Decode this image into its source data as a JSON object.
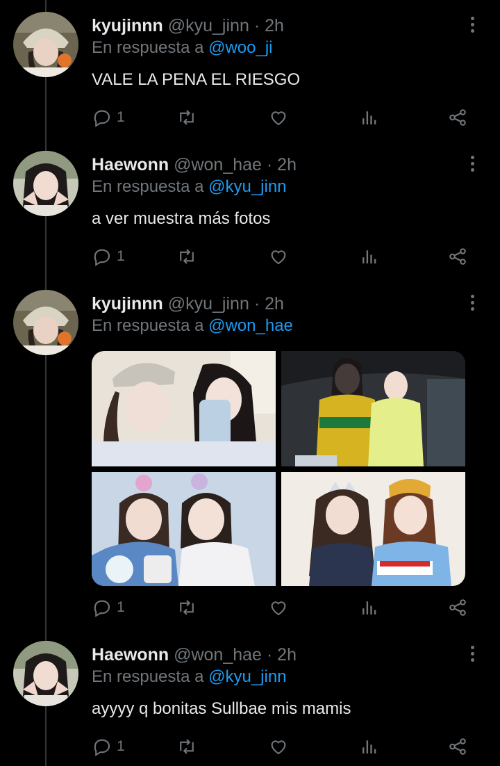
{
  "tweets": [
    {
      "name": "kyujinnn",
      "handle": "@kyu_jinn",
      "dot": "·",
      "time": "2h",
      "reply_prefix": "En respuesta a",
      "reply_to": "@woo_ji",
      "text": "VALE LA PENA EL RIESGO",
      "reply_count": "1",
      "avatar": "girl-with-beige-cap-avatar"
    },
    {
      "name": "Haewonn",
      "handle": "@won_hae",
      "dot": "·",
      "time": "2h",
      "reply_prefix": "En respuesta a",
      "reply_to": "@kyu_jinn",
      "text": "a ver muestra más fotos",
      "reply_count": "1",
      "avatar": "girl-hand-heart-avatar"
    },
    {
      "name": "kyujinnn",
      "handle": "@kyu_jinn",
      "dot": "·",
      "time": "2h",
      "reply_prefix": "En respuesta a",
      "reply_to": "@won_hae",
      "text": "",
      "reply_count": "1",
      "avatar": "girl-with-beige-cap-avatar",
      "media": [
        "mirror-selfie-photo",
        "umbrella-stage-photo",
        "headband-fansign-photo",
        "tiara-lotte-photo"
      ]
    },
    {
      "name": "Haewonn",
      "handle": "@won_hae",
      "dot": "·",
      "time": "2h",
      "reply_prefix": "En respuesta a",
      "reply_to": "@kyu_jinn",
      "text": "ayyyy q bonitas Sullbae mis mamis",
      "reply_count": "1",
      "avatar": "girl-hand-heart-avatar"
    }
  ],
  "colors": {
    "background": "#000000",
    "text": "#e7e9ea",
    "secondary": "#71767b",
    "accent": "#1d9bf0",
    "thread_line": "#333639"
  },
  "icons": [
    "reply-icon",
    "retweet-icon",
    "like-icon",
    "views-icon",
    "share-icon",
    "more-icon"
  ]
}
